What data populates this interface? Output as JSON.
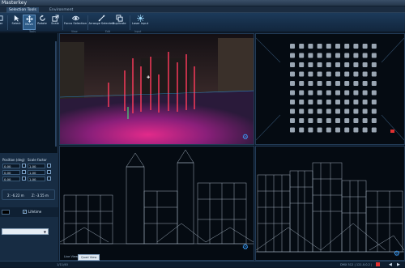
{
  "window": {
    "title": "Masterkey"
  },
  "tabs": [
    {
      "label": "Selection Tools"
    },
    {
      "label": "Environment"
    }
  ],
  "ribbon": {
    "buttons": [
      {
        "label": "Select",
        "icon": "cursor-icon"
      },
      {
        "label": "Move",
        "icon": "move-arrows-icon"
      },
      {
        "label": "Rotate",
        "icon": "rotate-icon"
      },
      {
        "label": "Scale",
        "icon": "scale-icon"
      },
      {
        "label": "Focus Selection",
        "icon": "eye-icon"
      },
      {
        "label": "Arrange Selected",
        "icon": "arrange-icon"
      },
      {
        "label": "Duplicate",
        "icon": "duplicate-icon"
      },
      {
        "label": "Laser Input",
        "icon": "laser-icon"
      }
    ],
    "groups": [
      "Tools",
      "View",
      "Edit",
      "Input"
    ],
    "left_edge_label": "ewer"
  },
  "props": {
    "position_header": "Position (deg)",
    "scale_header": "Scale factor",
    "position_values": [
      "0.00",
      "0.00",
      "0.00"
    ],
    "scale_values": [
      "1.00",
      "1.00",
      "1.00"
    ],
    "coord_left": "2: -6.22 m",
    "coord_right": "Z: -3.55 m",
    "checkbox_label": "Lifetime",
    "dropdown_value": ""
  },
  "views": {
    "bottom_tabs": [
      "Live View",
      "Quad View"
    ],
    "active_tab": "Quad View"
  },
  "status": {
    "left": "1/11/40",
    "right": "DMX 512 | 121.0.0.2 |"
  },
  "colors": {
    "accent": "#2c5a86",
    "panel": "#172c43",
    "viewport_bg": "#050b12"
  }
}
